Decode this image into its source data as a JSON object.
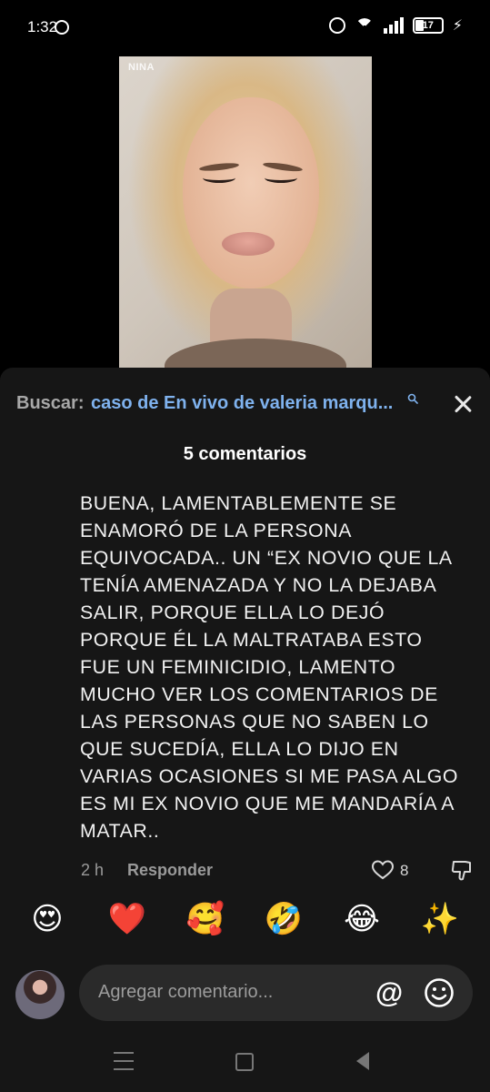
{
  "status_bar": {
    "time": "1:32",
    "battery": "17",
    "icons": [
      "whatsapp-icon",
      "alarm-icon",
      "wifi-icon",
      "signal-icon",
      "battery-icon",
      "charging-icon"
    ]
  },
  "video": {
    "overlay_tag": "NINA"
  },
  "search": {
    "label": "Buscar:",
    "query": "caso de En vivo de valeria marqu..."
  },
  "comments": {
    "count_label": "5 comentarios",
    "items": [
      {
        "text": "BUENA, LAMENTABLEMENTE SE ENAMORÓ DE LA PERSONA EQUIVOCADA.. UN “EX NOVIO QUE LA TENÍA AMENAZADA Y NO LA DEJABA SALIR, PORQUE ELLA LO DEJÓ PORQUE ÉL LA MALTRATABA ESTO FUE UN FEMINICIDIO, LAMENTO MUCHO VER LOS COMENTARIOS DE LAS PERSONAS QUE NO SABEN LO QUE SUCEDÍA, ELLA LO DIJO EN VARIAS OCASIONES SI ME PASA ALGO ES MI EX NOVIO QUE ME MANDARÍA A MATAR..",
        "time": "2 h",
        "reply_label": "Responder",
        "likes": "8"
      }
    ]
  },
  "quick_emojis": [
    "😍",
    "❤️",
    "🥰",
    "🤣",
    "😂",
    "✨"
  ],
  "composer": {
    "placeholder": "Agregar comentario...",
    "mention_symbol": "@"
  },
  "colors": {
    "background": "#000000",
    "sheet": "#161616",
    "link": "#7fb2ee",
    "muted": "#9a9a9a",
    "input": "#2a2a2a"
  }
}
